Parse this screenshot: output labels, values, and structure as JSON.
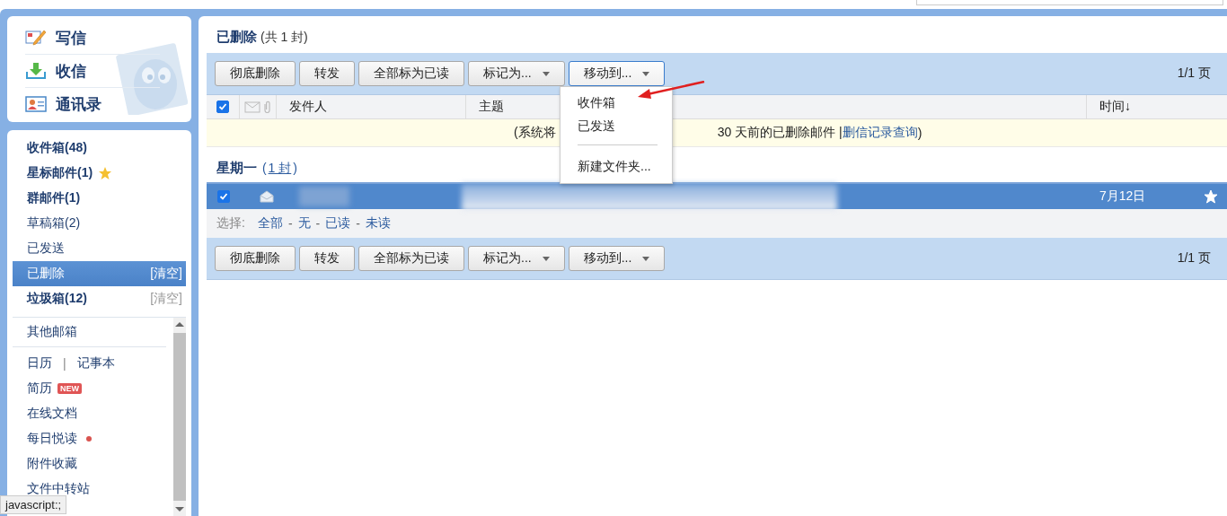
{
  "sidebar": {
    "actions": [
      {
        "label": "写信",
        "kind": "compose"
      },
      {
        "label": "收信",
        "kind": "receive"
      },
      {
        "label": "通讯录",
        "kind": "contacts"
      }
    ],
    "folders": [
      {
        "label": "收件箱(48)",
        "bold": true,
        "selected": false
      },
      {
        "label": "星标邮件(1)",
        "bold": true,
        "starred": true,
        "selected": false
      },
      {
        "label": "群邮件(1)",
        "bold": true,
        "selected": false
      },
      {
        "label": "草稿箱(2)",
        "bold": false,
        "selected": false
      },
      {
        "label": "已发送",
        "bold": false,
        "selected": false
      },
      {
        "label": "已删除",
        "bold": false,
        "selected": true,
        "clear": "[清空]"
      },
      {
        "label": "垃圾箱(12)",
        "bold": true,
        "selected": false,
        "clear": "[清空]"
      }
    ],
    "tools": [
      {
        "kind": "single",
        "label": "其他邮箱"
      },
      {
        "kind": "divider"
      },
      {
        "kind": "pair",
        "label": "日历",
        "separator": "|",
        "second": "记事本"
      },
      {
        "kind": "single",
        "label": "简历",
        "badge": "NEW"
      },
      {
        "kind": "single",
        "label": "在线文档"
      },
      {
        "kind": "single",
        "label": "每日悦读",
        "dot": true
      },
      {
        "kind": "single",
        "label": "附件收藏"
      },
      {
        "kind": "single",
        "label": "文件中转站"
      }
    ]
  },
  "status_tooltip": "javascript:;",
  "main": {
    "title": "已删除",
    "count": "(共 1 封)",
    "toolbar": [
      {
        "label": "彻底删除",
        "dropdown": false
      },
      {
        "label": "转发",
        "dropdown": false
      },
      {
        "label": "全部标为已读",
        "dropdown": false
      },
      {
        "label": "标记为...",
        "dropdown": true
      },
      {
        "label": "移动到...",
        "dropdown": true,
        "open": true
      }
    ],
    "pager": "1/1 页",
    "header_checked": true,
    "columns": [
      "发件人",
      "主题",
      "时间↓"
    ],
    "notice": {
      "left": "(系统将",
      "right": "30 天前的已删除邮件 | ",
      "link": "删信记录查询",
      "end": ")"
    },
    "group": {
      "label": "星期一",
      "open": "(",
      "count": "1 封",
      "close": ")"
    },
    "messages": [
      {
        "selected": true,
        "checked": true,
        "date": "7月12日",
        "starred": true
      }
    ],
    "select_bar": {
      "label": "选择:",
      "options": [
        "全部",
        "无",
        "已读",
        "未读"
      ],
      "separator": "-"
    },
    "bottom_toolbar": [
      {
        "label": "彻底删除",
        "dropdown": false
      },
      {
        "label": "转发",
        "dropdown": false
      },
      {
        "label": "全部标为已读",
        "dropdown": false
      },
      {
        "label": "标记为...",
        "dropdown": true
      },
      {
        "label": "移动到...",
        "dropdown": true
      }
    ],
    "bottom_pager": "1/1 页",
    "open_menu": {
      "items": [
        {
          "kind": "item",
          "label": "收件箱"
        },
        {
          "kind": "item",
          "label": "已发送"
        },
        {
          "kind": "divider"
        },
        {
          "kind": "item",
          "label": "新建文件夹..."
        }
      ]
    }
  }
}
